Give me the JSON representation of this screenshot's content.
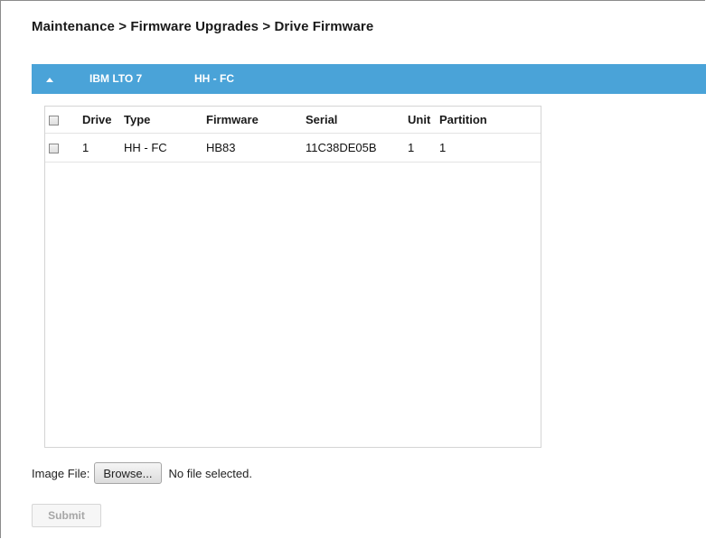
{
  "breadcrumb": "Maintenance > Firmware Upgrades > Drive Firmware",
  "group": {
    "model": "IBM LTO 7",
    "type": "HH - FC",
    "collapse_icon": "triangle-up-icon",
    "color": "#4aa3d8"
  },
  "table": {
    "columns": [
      "Drive",
      "Type",
      "Firmware",
      "Serial",
      "Unit",
      "Partition"
    ],
    "rows": [
      {
        "checked": false,
        "drive": "1",
        "type": "HH - FC",
        "firmware": "HB83",
        "serial": "11C38DE05B",
        "unit": "1",
        "partition": "1"
      }
    ]
  },
  "file_upload": {
    "label": "Image File:",
    "button_label": "Browse...",
    "status": "No file selected."
  },
  "submit": {
    "label": "Submit",
    "disabled": true
  }
}
